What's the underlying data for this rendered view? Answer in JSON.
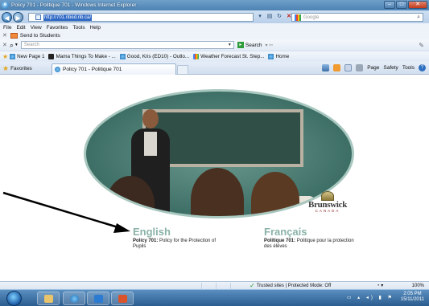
{
  "window": {
    "title": "Policy 701 - Politique 701 - Windows Internet Explorer"
  },
  "address_bar": {
    "url": "http://701.nbed.nb.ca/",
    "search_placeholder": "Google"
  },
  "menu": [
    "File",
    "Edit",
    "View",
    "Favorites",
    "Tools",
    "Help"
  ],
  "send_bar": {
    "label": "Send to Students"
  },
  "search_toolbar": {
    "placeholder": "Search",
    "button_label": "Search"
  },
  "favorites_bar": {
    "items": [
      "New Page 1",
      "Mama Things To Make - ...",
      "Good, Kris (ED10) - Outlo...",
      "Weather Forecast St. Step...",
      "Home"
    ]
  },
  "tab_bar": {
    "favorites_label": "Favorites",
    "active_tab": "Policy 701 - Politique 701",
    "commands": [
      "Page",
      "Safety",
      "Tools"
    ]
  },
  "page": {
    "brand_name": "Brunswick",
    "brand_country": "CANADA",
    "english": {
      "heading": "English",
      "policy_label": "Policy 701:",
      "policy_text": "Policy for the Protection of Pupils"
    },
    "french": {
      "heading": "Français",
      "policy_label": "Politique 701:",
      "policy_text": "Politique pour la protection des élèves"
    }
  },
  "status_bar": {
    "zone": "Trusted sites | Protected Mode: Off",
    "zoom": "100%"
  },
  "taskbar": {
    "time": "2:05 PM",
    "date": "15/11/2011"
  },
  "colors": {
    "heading_green": "#8bb2a8",
    "ie_blue": "#4d82b3"
  }
}
